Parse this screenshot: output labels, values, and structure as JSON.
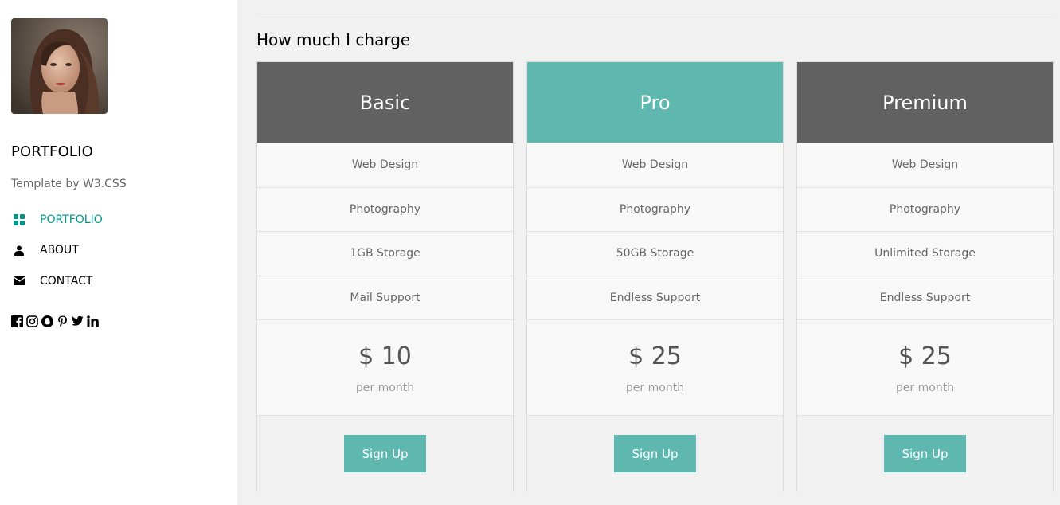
{
  "sidebar": {
    "brand": "PORTFOLIO",
    "tagline": "Template by W3.CSS",
    "nav": [
      {
        "label": "PORTFOLIO",
        "icon": "grid-icon",
        "active": true
      },
      {
        "label": "ABOUT",
        "icon": "user-icon",
        "active": false
      },
      {
        "label": "CONTACT",
        "icon": "envelope-icon",
        "active": false
      }
    ],
    "social": [
      "facebook-icon",
      "instagram-icon",
      "snapchat-icon",
      "pinterest-icon",
      "twitter-icon",
      "linkedin-icon"
    ]
  },
  "main": {
    "title": "How much I charge",
    "plans": [
      {
        "name": "Basic",
        "features": [
          "Web Design",
          "Photography",
          "1GB Storage",
          "Mail Support"
        ],
        "price": "$ 10",
        "period": "per month",
        "button": "Sign Up"
      },
      {
        "name": "Pro",
        "features": [
          "Web Design",
          "Photography",
          "50GB Storage",
          "Endless Support"
        ],
        "price": "$ 25",
        "period": "per month",
        "button": "Sign Up"
      },
      {
        "name": "Premium",
        "features": [
          "Web Design",
          "Photography",
          "Unlimited Storage",
          "Endless Support"
        ],
        "price": "$ 25",
        "period": "per month",
        "button": "Sign Up"
      }
    ]
  },
  "colors": {
    "accent": "#009688",
    "teal": "#5fb8af",
    "dark_header": "#616161"
  }
}
